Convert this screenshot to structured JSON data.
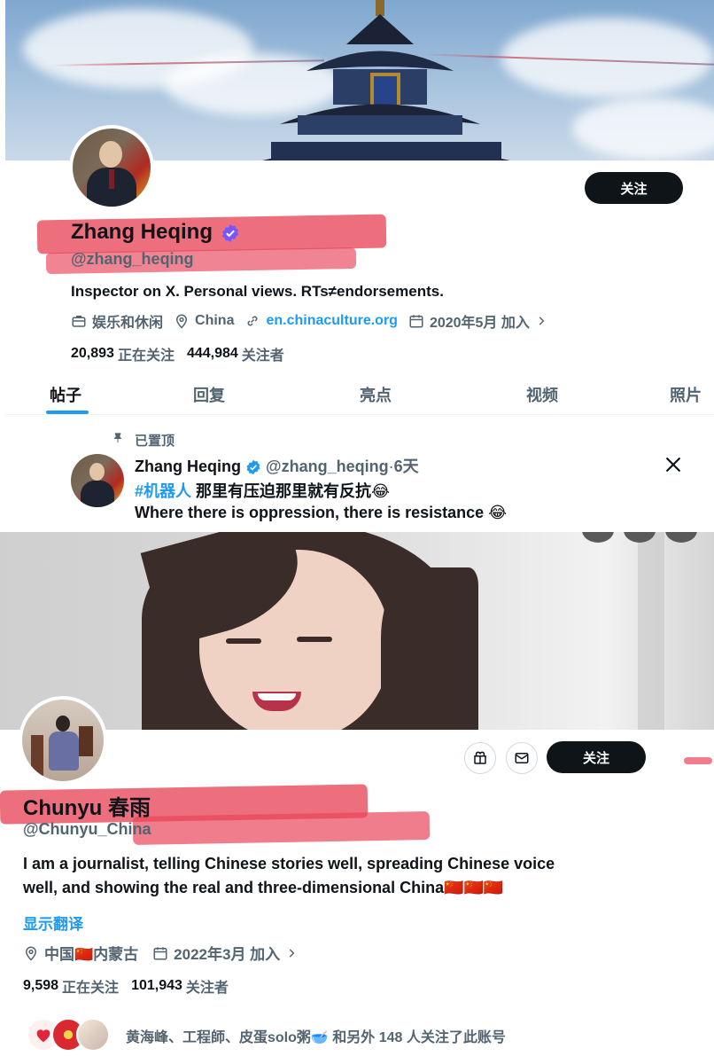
{
  "profile1": {
    "follow_label": "关注",
    "name": "Zhang Heqing",
    "handle": "@zhang_heqing",
    "bio": "Inspector on X. Personal views. RTs≠endorsements.",
    "category": "娱乐和休闲",
    "location": "China",
    "website": "en.chinaculture.org",
    "joined": "2020年5月 加入",
    "following_count": "20,893",
    "following_label": "正在关注",
    "followers_count": "444,984",
    "followers_label": "关注者",
    "tabs": [
      "帖子",
      "回复",
      "亮点",
      "视频",
      "照片"
    ],
    "pinned": {
      "pinned_label": "已置顶",
      "author_name": "Zhang Heqing",
      "author_handle": "@zhang_heqing",
      "time": "6天",
      "hashtag": "#机器人",
      "line1_text": "那里有压迫那里就有反抗😂",
      "line2_text": "Where there is oppression, there is resistance 😂"
    }
  },
  "profile2": {
    "follow_label": "关注",
    "name": "Chunyu 春雨",
    "handle": "@Chunyu_China",
    "bio_line1": "I am a journalist, telling Chinese stories well, spreading Chinese voice",
    "bio_line2": "well, and showing the real and three-dimensional China🇨🇳🇨🇳🇨🇳",
    "translate": "显示翻译",
    "location": "中国🇨🇳内蒙古",
    "joined": "2022年3月 加入",
    "following_count": "9,598",
    "following_label": "正在关注",
    "followers_count": "101,943",
    "followers_label": "关注者",
    "followed_by": "黄海峰、工程師、皮蛋solo粥🥣 和另外 148 人关注了此账号"
  },
  "colors": {
    "accent": "#1d9bf0",
    "text": "#0f1419",
    "secondary": "#536471",
    "highlight": "#e8465a",
    "button": "#0f1419"
  }
}
